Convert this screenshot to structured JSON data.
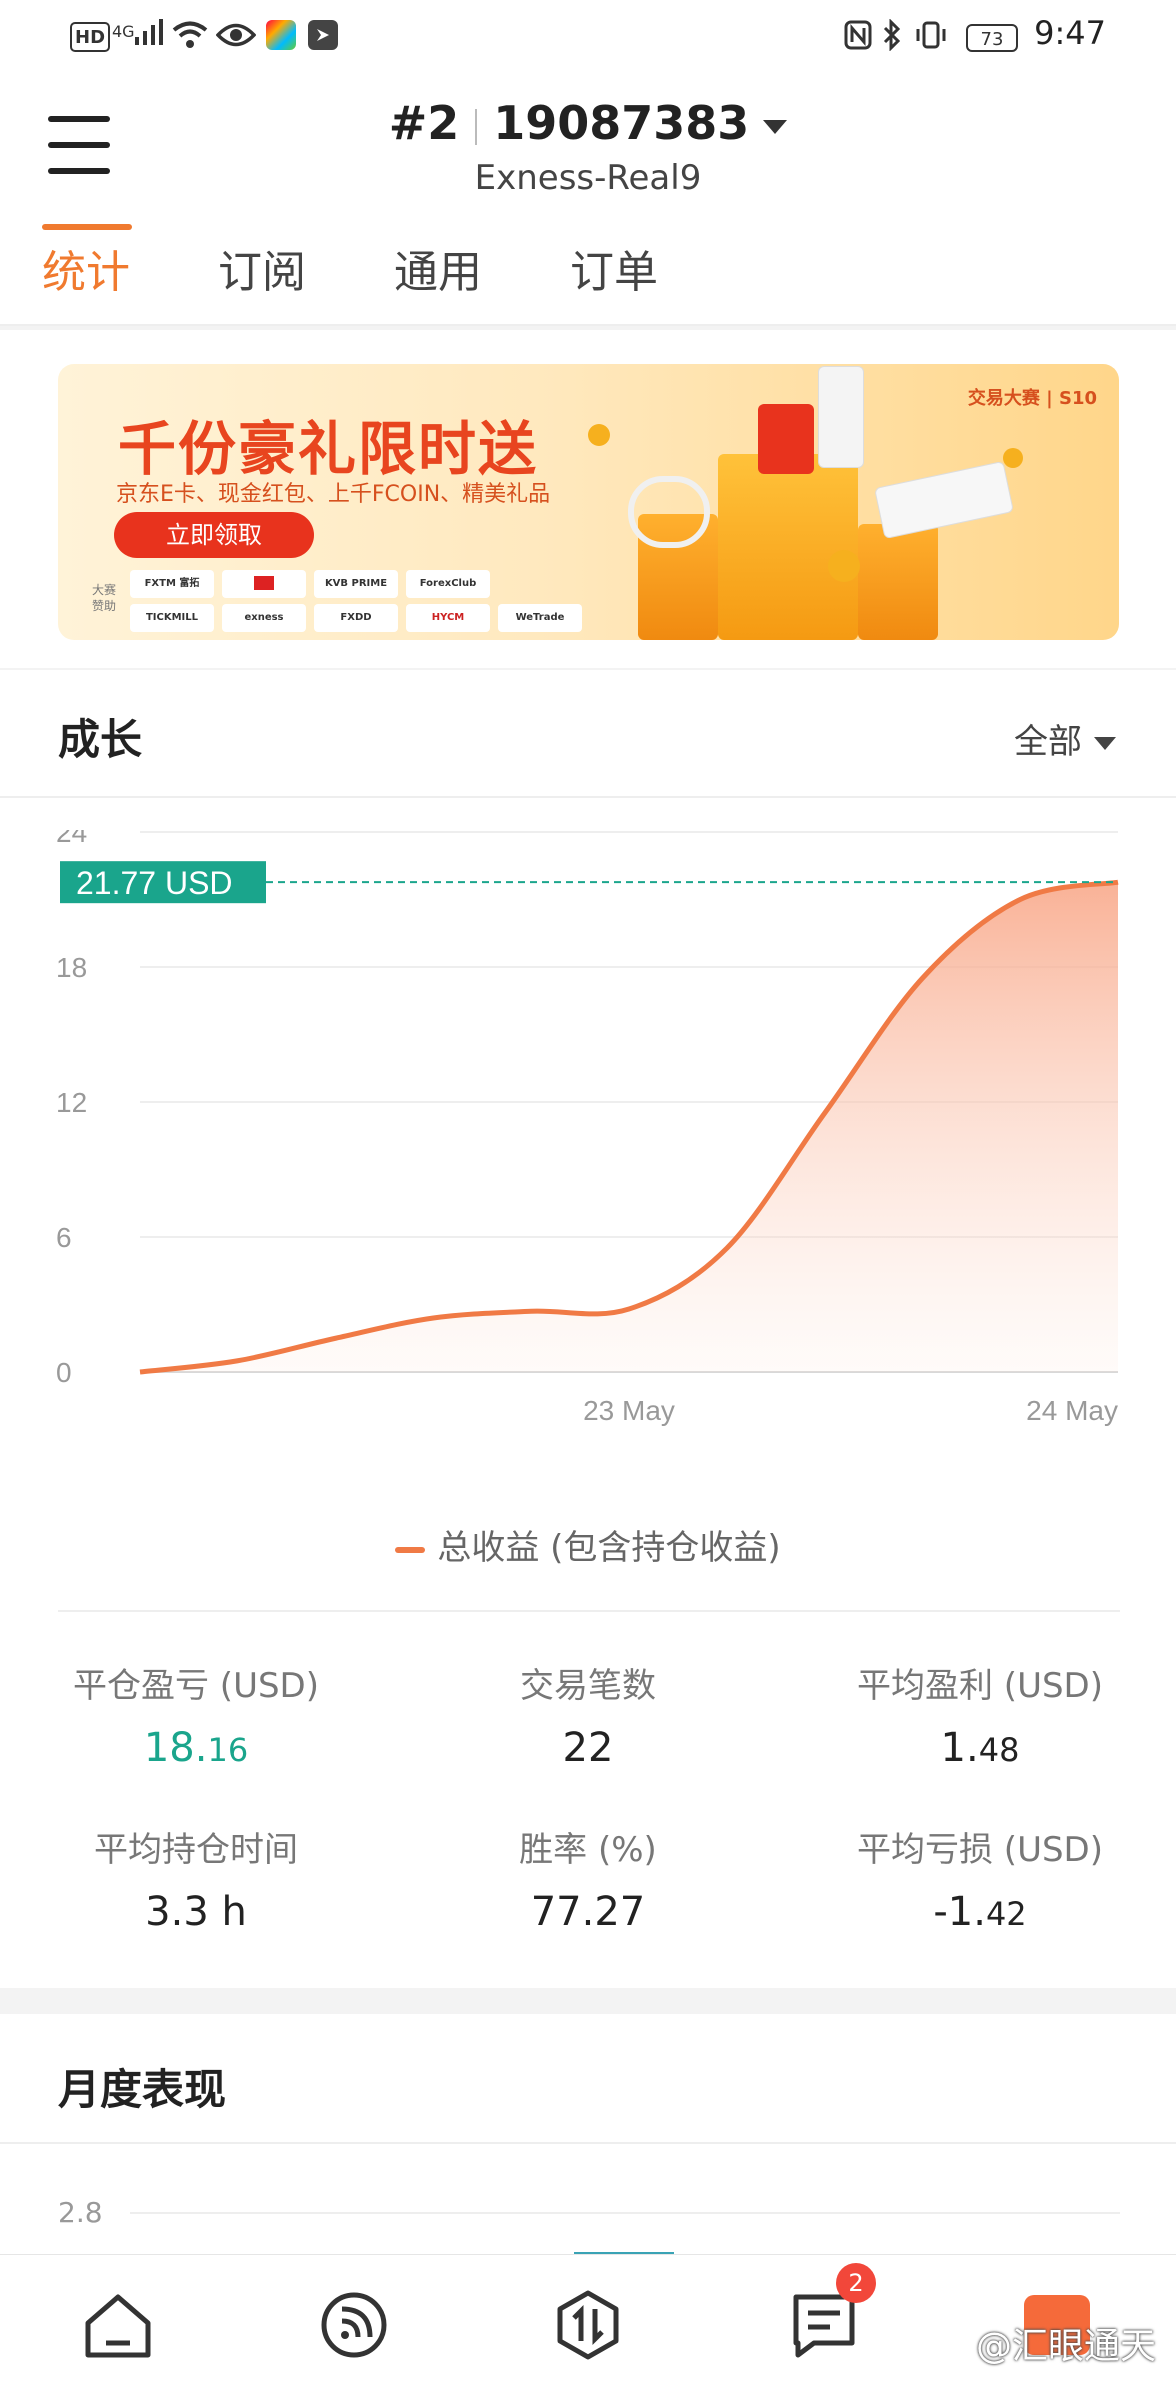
{
  "status_bar": {
    "network_label": "HD",
    "signal_label": "4G",
    "battery": "73",
    "time": "9:47"
  },
  "header": {
    "rank": "#2",
    "account_number": "19087383",
    "server": "Exness-Real9"
  },
  "tabs": [
    {
      "label": "统计",
      "active": true
    },
    {
      "label": "订阅",
      "active": false
    },
    {
      "label": "通用",
      "active": false
    },
    {
      "label": "订单",
      "active": false
    }
  ],
  "banner": {
    "title": "千份豪礼限时送",
    "subtitle": "京东E卡、现金红包、上千FCOIN、精美礼品",
    "button": "立即领取",
    "brand": "交易大赛 | S10",
    "sponsor_label": "大赛赞助",
    "sponsors": [
      "FXTM 富拓",
      "",
      "KVB PRIME",
      "ForexClub",
      "TICKMILL",
      "exness",
      "FXDD",
      "HYCM",
      "WeTrade"
    ]
  },
  "growth": {
    "title": "成长",
    "filter": "全部",
    "legend": "总收益 (包含持仓收益)",
    "current_label": "21.77 USD"
  },
  "chart_data": {
    "type": "area",
    "x_ticks": [
      "23 May",
      "24 May"
    ],
    "y_ticks": [
      "24",
      "18",
      "12",
      "6",
      "0"
    ],
    "ylim": [
      0,
      24
    ],
    "series": [
      {
        "name": "总收益 (包含持仓收益)",
        "x": [
          0,
          0.1,
          0.2,
          0.3,
          0.4,
          0.5,
          0.6,
          0.7,
          0.8,
          0.9,
          1.0
        ],
        "values": [
          0,
          0.5,
          1.5,
          2.4,
          2.7,
          2.8,
          5.5,
          11.5,
          17.5,
          21.0,
          21.77
        ]
      }
    ],
    "reference_value": 21.77,
    "colors": {
      "line": "#f07a45",
      "fill": "#fbc3a8",
      "reference": "#1aa58c"
    }
  },
  "stats": [
    {
      "label": "平仓盈亏 (USD)",
      "value_int": "18.",
      "value_dec": "16",
      "highlight": true
    },
    {
      "label": "交易笔数",
      "value_int": "22",
      "value_dec": "",
      "highlight": false
    },
    {
      "label": "平均盈利 (USD)",
      "value_int": "1.",
      "value_dec": "48",
      "highlight": false
    },
    {
      "label": "平均持仓时间",
      "value_int": "3.3 h",
      "value_dec": "",
      "highlight": false
    },
    {
      "label": "胜率 (%)",
      "value_int": "77.27",
      "value_dec": "",
      "highlight": false
    },
    {
      "label": "平均亏损 (USD)",
      "value_int": "-1.",
      "value_dec": "42",
      "highlight": false
    }
  ],
  "monthly": {
    "title": "月度表现",
    "y_tick": "2.8"
  },
  "bottom_nav": {
    "items": [
      "home-icon",
      "feed-icon",
      "trade-icon",
      "messages-icon",
      "profile-icon"
    ],
    "messages_badge": "2",
    "watermark": "@汇眼通天"
  }
}
